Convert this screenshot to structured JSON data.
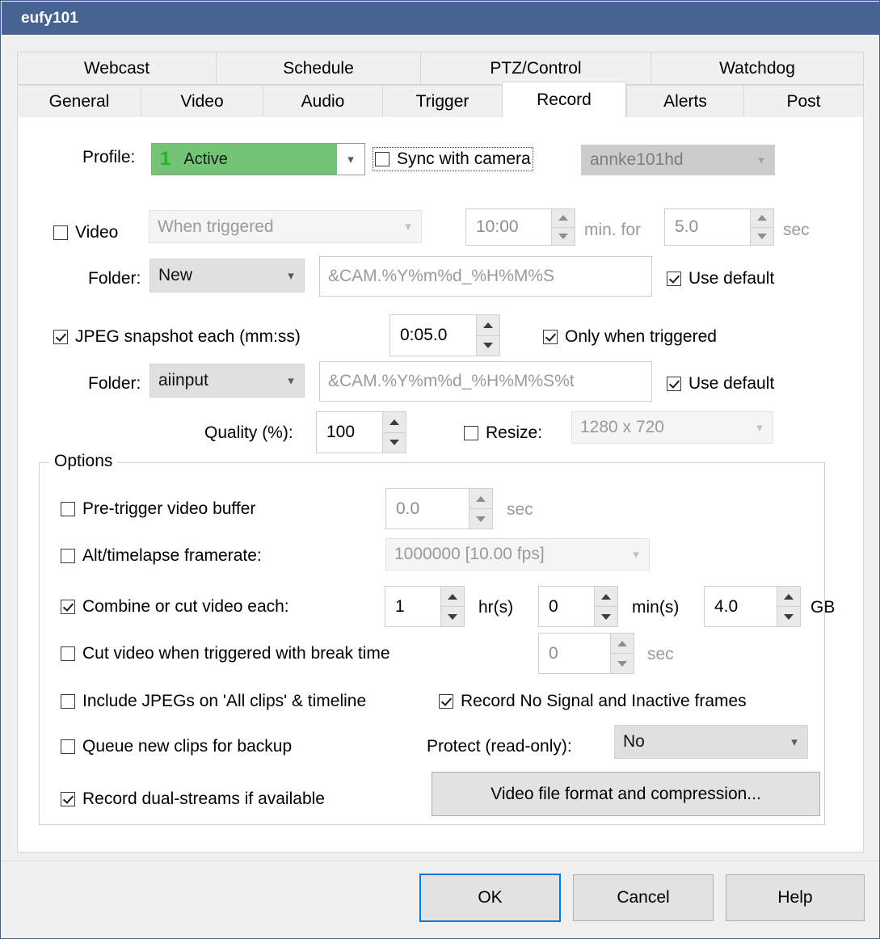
{
  "window": {
    "title": "eufy101"
  },
  "tabs": {
    "top_row": [
      {
        "label": "Webcast",
        "active": false
      },
      {
        "label": "Schedule",
        "active": false
      },
      {
        "label": "PTZ/Control",
        "active": false
      },
      {
        "label": "Watchdog",
        "active": false
      }
    ],
    "bottom_row": [
      {
        "label": "General",
        "active": false
      },
      {
        "label": "Video",
        "active": false
      },
      {
        "label": "Audio",
        "active": false
      },
      {
        "label": "Trigger",
        "active": false
      },
      {
        "label": "Record",
        "active": true
      },
      {
        "label": "Alerts",
        "active": false
      },
      {
        "label": "Post",
        "active": false
      }
    ]
  },
  "profile_row": {
    "label": "Profile:",
    "profile_number": "1",
    "profile_value": "Active",
    "sync_label": "Sync with camera",
    "sync_checked": false,
    "camera_value": "annke101hd"
  },
  "video_row": {
    "checkbox_label": "Video",
    "checked": false,
    "mode_value": "When triggered",
    "minutes_value": "10:00",
    "minutes_unit": "min. for",
    "seconds_value": "5.0",
    "seconds_unit": "sec"
  },
  "video_folder_row": {
    "label": "Folder:",
    "folder_value": "New",
    "path_value": "&CAM.%Y%m%d_%H%M%S",
    "use_default_label": "Use default",
    "use_default_checked": true
  },
  "jpeg_row": {
    "label": "JPEG snapshot each (mm:ss)",
    "checked": true,
    "interval_value": "0:05.0",
    "only_triggered_label": "Only when triggered",
    "only_triggered_checked": true
  },
  "jpeg_folder_row": {
    "label": "Folder:",
    "folder_value": "aiinput",
    "path_value": "&CAM.%Y%m%d_%H%M%S%t",
    "use_default_label": "Use default",
    "use_default_checked": true
  },
  "quality_row": {
    "label": "Quality (%):",
    "value": "100",
    "resize_label": "Resize:",
    "resize_checked": false,
    "resize_value": "1280 x 720"
  },
  "options": {
    "title": "Options",
    "pretrigger": {
      "label": "Pre-trigger video buffer",
      "checked": false,
      "value": "0.0",
      "unit": "sec"
    },
    "alt_framerate": {
      "label": "Alt/timelapse framerate:",
      "checked": false,
      "value": "1000000 [10.00 fps]"
    },
    "combine": {
      "label": "Combine or cut video each:",
      "checked": true,
      "hours_value": "1",
      "hours_unit": "hr(s)",
      "minutes_value": "0",
      "minutes_unit": "min(s)",
      "size_value": "4.0",
      "size_unit": "GB"
    },
    "cut_on_trigger": {
      "label": "Cut video when triggered with break time",
      "checked": false,
      "value": "0",
      "unit": "sec"
    },
    "include_jpegs": {
      "label": "Include JPEGs on 'All clips' & timeline",
      "checked": false
    },
    "record_no_signal": {
      "label": "Record No Signal and Inactive frames",
      "checked": true
    },
    "queue_backup": {
      "label": "Queue new clips for backup",
      "checked": false
    },
    "protect": {
      "label": "Protect (read-only):",
      "value": "No"
    },
    "dual_streams": {
      "label": "Record dual-streams if available",
      "checked": true
    },
    "video_format_button": "Video file format and compression..."
  },
  "footer": {
    "ok": "OK",
    "cancel": "Cancel",
    "help": "Help"
  },
  "icons": {
    "chevron_down": "⌄"
  },
  "colors": {
    "titlebar": "#46648f",
    "profile_green": "#74c476",
    "profile_number_green": "#22b422",
    "default_button_border": "#0078d7"
  }
}
